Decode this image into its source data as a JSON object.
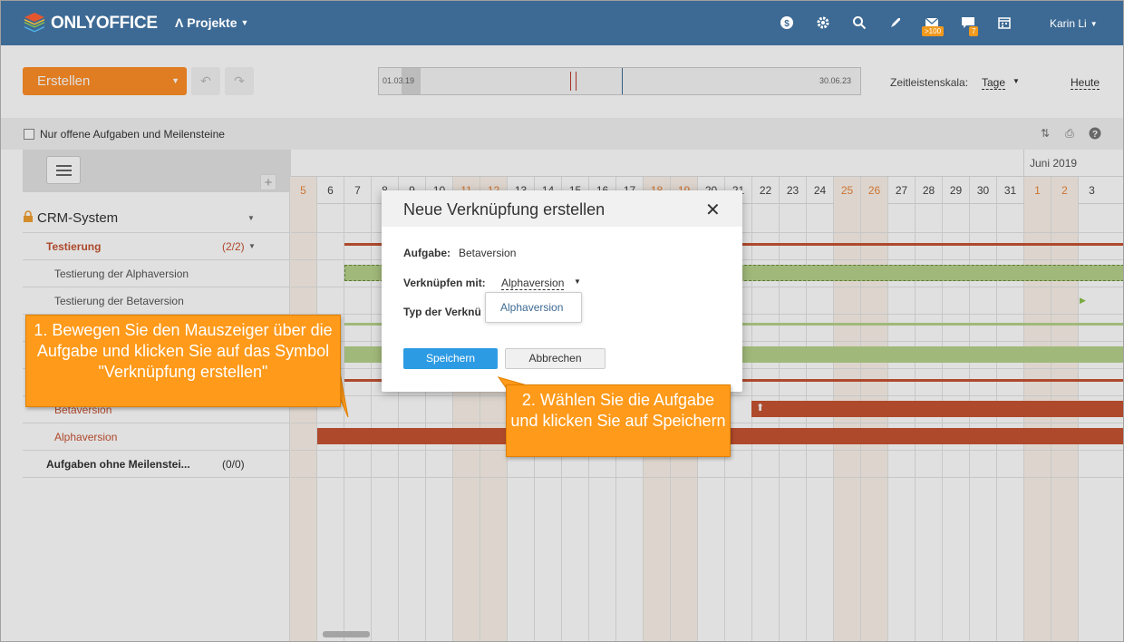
{
  "header": {
    "logo_text": "ONLYOFFICE",
    "module_label": "Projekte",
    "user_name": "Karin Li",
    "mail_badge": ">100",
    "chat_badge": "7",
    "icons": [
      "dollar-icon",
      "gear-icon",
      "search-icon",
      "rocket-icon",
      "mail-icon",
      "chat-icon",
      "calendar-icon"
    ]
  },
  "toolbar": {
    "create_label": "Erstellen",
    "timeline_start": "01.03.19",
    "timeline_end": "30.06.23",
    "scale_label": "Zeitleistenskala:",
    "scale_value": "Tage",
    "today_label": "Heute"
  },
  "filter": {
    "open_only_label": "Nur offene Aufgaben und Meilensteine"
  },
  "tree": {
    "project": "CRM-System",
    "milestone": "Testierung",
    "milestone_count": "(2/2)",
    "tasks": [
      "Testierung der Alphaversion",
      "Testierung der Betaversion"
    ],
    "hidden_milestone_label": "Betaversion",
    "alpha_label": "Alphaversion",
    "no_milestone_label": "Aufgaben ohne Meilenstei...",
    "no_milestone_count": "(0/0)"
  },
  "gantt": {
    "month_label": "Juni 2019",
    "days": [
      "5",
      "6",
      "7",
      "8",
      "9",
      "10",
      "11",
      "12",
      "13",
      "14",
      "15",
      "16",
      "17",
      "18",
      "19",
      "20",
      "21",
      "22",
      "23",
      "24",
      "25",
      "26",
      "27",
      "28",
      "29",
      "30",
      "31",
      "1",
      "2",
      "3"
    ],
    "weekend_days": [
      "5",
      "11",
      "12",
      "18",
      "19",
      "25",
      "26",
      "1",
      "2"
    ],
    "colors": {
      "milestone_bar": "#c65433",
      "task_bar": "#b7d38b",
      "weekend": "#fcf3ea"
    }
  },
  "dialog": {
    "title": "Neue Verknüpfung erstellen",
    "task_label": "Aufgabe:",
    "task_value": "Betaversion",
    "link_label": "Verknüpfen mit:",
    "link_value": "Alphaversion",
    "type_label": "Typ der Verknü",
    "dropdown_option": "Alphaversion",
    "save_label": "Speichern",
    "cancel_label": "Abbrechen"
  },
  "callouts": {
    "step1": "1. Bewegen Sie den Mauszeiger über die Aufgabe und klicken Sie auf das Symbol \"Verknüpfung erstellen\"",
    "step2": "2. Wählen Sie die Aufgabe und klicken Sie auf Speichern"
  }
}
